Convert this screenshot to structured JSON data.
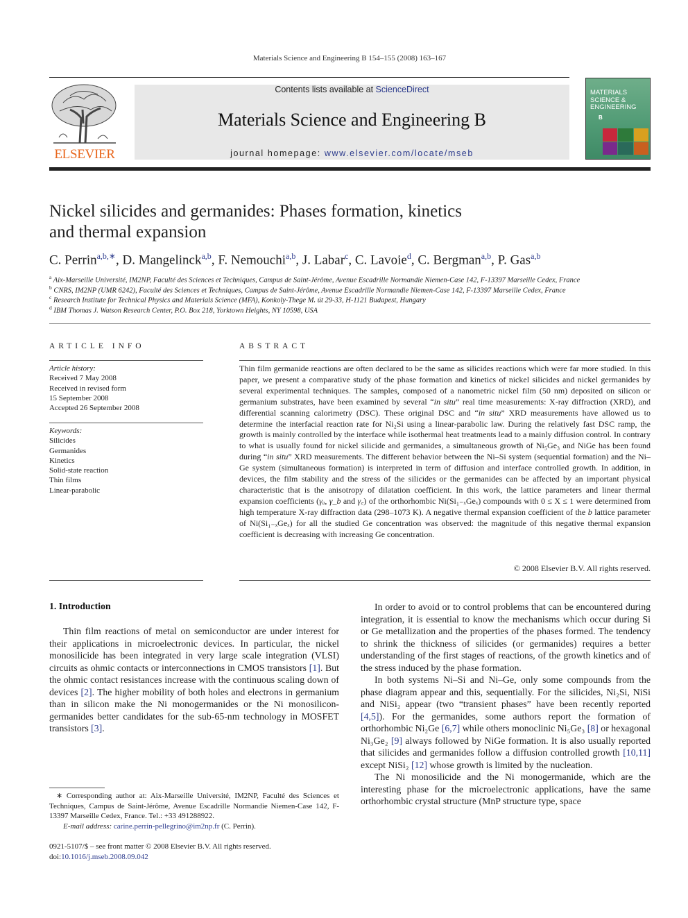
{
  "running_header": "Materials Science and Engineering B 154–155 (2008) 163–167",
  "masthead": {
    "contents_prefix": "Contents lists available at ",
    "contents_link": "ScienceDirect",
    "journal_title": "Materials Science and Engineering B",
    "homepage_prefix": "journal homepage: ",
    "homepage_link": "www.elsevier.com/locate/mseb",
    "publisher_logo": "ELSEVIER",
    "cover_title": "MATERIALS SCIENCE & ENGINEERING",
    "cover_letter": "B",
    "accent_color": "#e8661c",
    "link_color": "#2b3a8c"
  },
  "article": {
    "title_line1": "Nickel silicides and germanides: Phases formation, kinetics",
    "title_line2": "and thermal expansion",
    "authors": [
      {
        "name": "C. Perrin",
        "sup": "a,b,∗"
      },
      {
        "name": "D. Mangelinck",
        "sup": "a,b"
      },
      {
        "name": "F. Nemouchi",
        "sup": "a,b"
      },
      {
        "name": "J. Labar",
        "sup": "c"
      },
      {
        "name": "C. Lavoie",
        "sup": "d"
      },
      {
        "name": "C. Bergman",
        "sup": "a,b"
      },
      {
        "name": "P. Gas",
        "sup": "a,b"
      }
    ],
    "affiliations": [
      {
        "key": "a",
        "text": "Aix-Marseille Université, IM2NP, Faculté des Sciences et Techniques, Campus de Saint-Jérôme, Avenue Escadrille Normandie Niemen-Case 142, F-13397 Marseille Cedex, France"
      },
      {
        "key": "b",
        "text": "CNRS, IM2NP (UMR 6242), Faculté des Sciences et Techniques, Campus de Saint-Jérôme, Avenue Escadrille Normandie Niemen-Case 142, F-13397 Marseille Cedex, France"
      },
      {
        "key": "c",
        "text": "Research Institute for Technical Physics and Materials Science (MFA), Konkoly-Thege M. út 29-33, H-1121 Budapest, Hungary"
      },
      {
        "key": "d",
        "text": "IBM Thomas J. Watson Research Center, P.O. Box 218, Yorktown Heights, NY 10598, USA"
      }
    ]
  },
  "article_info": {
    "heading": "ARTICLE INFO",
    "history_label": "Article history:",
    "history": [
      "Received 7 May 2008",
      "Received in revised form",
      "15 September 2008",
      "Accepted 26 September 2008"
    ],
    "keywords_label": "Keywords:",
    "keywords": [
      "Silicides",
      "Germanides",
      "Kinetics",
      "Solid-state reaction",
      "Thin films",
      "Linear-parabolic"
    ]
  },
  "abstract": {
    "heading": "ABSTRACT",
    "segments": [
      {
        "t": "Thin film germanide reactions are often declared to be the same as silicides reactions which were far more studied. In this paper, we present a comparative study of the phase formation and kinetics of nickel silicides and nickel germanides by several experimental techniques. The samples, composed of a nanometric nickel film (50 nm) deposited on silicon or germanium substrates, have been examined by several “"
      },
      {
        "i": "in situ"
      },
      {
        "t": "” real time measurements: X-ray diffraction (XRD), and differential scanning calorimetry (DSC). These original DSC and “"
      },
      {
        "i": "in situ"
      },
      {
        "t": "” XRD measurements have allowed us to determine the interfacial reaction rate for Ni₂Si using a linear-parabolic law. During the relatively fast DSC ramp, the growth is mainly controlled by the interface while isothermal heat treatments lead to a mainly diffusion control. In contrary to what is usually found for nickel silicide and germanides, a simultaneous growth of Ni₅Ge₃ and NiGe has been found during “"
      },
      {
        "i": "in situ"
      },
      {
        "t": "” XRD measurements. The different behavior between the Ni–Si system (sequential formation) and the Ni–Ge system (simultaneous formation) is interpreted in term of diffusion and interface controlled growth. In addition, in devices, the film stability and the stress of the silicides or the germanides can be affected by an important physical characteristic that is the anisotropy of dilatation coefficient. In this work, the lattice parameters and linear thermal expansion coefficients ("
      },
      {
        "i": "γₐ"
      },
      {
        "t": ", "
      },
      {
        "i": "γ_b"
      },
      {
        "t": " and "
      },
      {
        "i": "γ꜀"
      },
      {
        "t": ") of the orthorhombic Ni(Si₁₋ₓGeₓ) compounds with 0 ≤ X ≤ 1 were determined from high temperature X-ray diffraction data (298–1073 K). A negative thermal expansion coefficient of the "
      },
      {
        "i": "b"
      },
      {
        "t": " lattice parameter of Ni(Si₁₋ₓGeₓ) for all the studied Ge concentration was observed: the magnitude of this negative thermal expansion coefficient is decreasing with increasing Ge concentration."
      }
    ],
    "copyright": "© 2008 Elsevier B.V. All rights reserved."
  },
  "body": {
    "section_heading": "1.  Introduction",
    "left_paragraphs": [
      [
        {
          "t": "Thin film reactions of metal on semiconductor are under interest for their applications in microelectronic devices. In particular, the nickel monosilicide has been integrated in very large scale integration (VLSI) circuits as ohmic contacts or interconnections in CMOS transistors "
        },
        {
          "r": "[1]"
        },
        {
          "t": ". But the ohmic contact resistances increase with the continuous scaling down of devices "
        },
        {
          "r": "[2]"
        },
        {
          "t": ". The higher mobility of both holes and electrons in germanium than in silicon make the Ni monogermanides or the Ni monosilicon-germanides better candidates for the sub-65-nm technology in MOSFET transistors "
        },
        {
          "r": "[3]"
        },
        {
          "t": "."
        }
      ]
    ],
    "right_paragraphs": [
      [
        {
          "t": "In order to avoid or to control problems that can be encountered during integration, it is essential to know the mechanisms which occur during Si or Ge metallization and the properties of the phases formed. The tendency to shrink the thickness of silicides (or germanides) requires a better understanding of the first stages of reactions, of the growth kinetics and of the stress induced by the phase formation."
        }
      ],
      [
        {
          "t": "In both systems Ni–Si and Ni–Ge, only some compounds from the phase diagram appear and this, sequentially. For the silicides, Ni₂Si, NiSi and NiSi₂ appear (two “transient phases” have been recently reported "
        },
        {
          "r": "[4,5]"
        },
        {
          "t": "). For the germanides, some authors report the formation of orthorhombic Ni₂Ge "
        },
        {
          "r": "[6,7]"
        },
        {
          "t": " while others monoclinic Ni₅Ge₃ "
        },
        {
          "r": "[8]"
        },
        {
          "t": " or hexagonal Ni₃Ge₂ "
        },
        {
          "r": "[9]"
        },
        {
          "t": " always followed by NiGe formation. It is also usually reported that silicides and germanides follow a diffusion controlled growth "
        },
        {
          "r": "[10,11]"
        },
        {
          "t": " except NiSi₂ "
        },
        {
          "r": "[12]"
        },
        {
          "t": " whose growth is limited by the nucleation."
        }
      ],
      [
        {
          "t": "The Ni monosilicide and the Ni monogermanide, which are the interesting phase for the microelectronic applications, have the same orthorhombic crystal structure (MnP structure type, space"
        }
      ]
    ]
  },
  "footnote": {
    "corresponding": "∗  Corresponding author at: Aix-Marseille Université, IM2NP, Faculté des Sciences et Techniques, Campus de Saint-Jérôme, Avenue Escadrille Normandie Niemen-Case 142, F-13397 Marseille Cedex, France. Tel.: +33 491288922.",
    "email_label": "E-mail address: ",
    "email": "carine.perrin-pellegrino@im2np.fr",
    "email_suffix": " (C. Perrin).",
    "front_matter": "0921-5107/$ – see front matter © 2008 Elsevier B.V. All rights reserved.",
    "doi_label": "doi:",
    "doi": "10.1016/j.mseb.2008.09.042"
  }
}
